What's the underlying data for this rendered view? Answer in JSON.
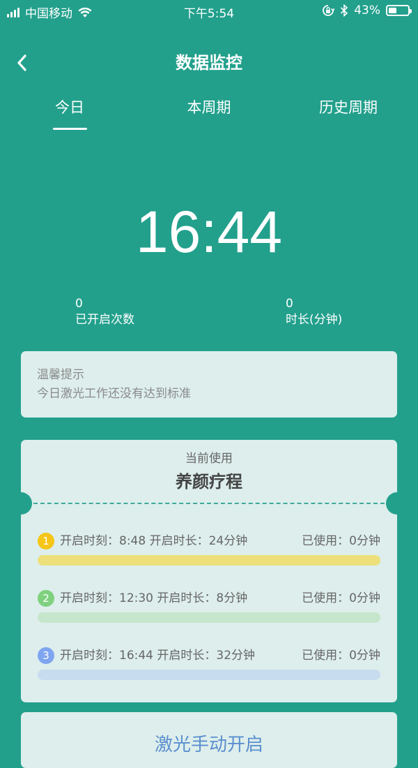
{
  "status_bar": {
    "carrier": "中国移动",
    "time": "下午5:54",
    "battery": "43%",
    "battery_level": 0.43,
    "icons": [
      "signal-icon",
      "wifi-icon",
      "orientation-lock-icon",
      "bluetooth-icon",
      "battery-icon"
    ]
  },
  "nav": {
    "title": "数据监控",
    "back_icon": "back-arrow-icon"
  },
  "tabs": [
    {
      "label": "今日",
      "active": true
    },
    {
      "label": "本周期",
      "active": false
    },
    {
      "label": "历史周期",
      "active": false
    }
  ],
  "big_time": "16:44",
  "stats": [
    {
      "value": "0",
      "label": "已开启次数"
    },
    {
      "value": "0",
      "label": "时长(分钟)"
    }
  ],
  "tip": {
    "title": "温馨提示",
    "text": "今日激光工作还没有达到标准"
  },
  "course": {
    "subtitle": "当前使用",
    "title": "养颜疗程",
    "sessions": [
      {
        "num": "1",
        "info": "开启时刻：8:48 开启时长：24分钟",
        "used": "已使用：0分钟",
        "num_color": "#F5C518",
        "bar_color": "#EDE07A"
      },
      {
        "num": "2",
        "info": "开启时刻：12:30 开启时长：8分钟",
        "used": "已使用：0分钟",
        "num_color": "#7FD17F",
        "bar_color": "#C6E6CC"
      },
      {
        "num": "3",
        "info": "开启时刻：16:44 开启时长：32分钟",
        "used": "已使用：0分钟",
        "num_color": "#7FA5F0",
        "bar_color": "#C8DCEF"
      }
    ]
  },
  "manual_button": {
    "label": "激光手动开启"
  },
  "colors": {
    "background": "#22A08C",
    "card": "#DDEEEC",
    "accent_text": "#5B8FCF"
  }
}
